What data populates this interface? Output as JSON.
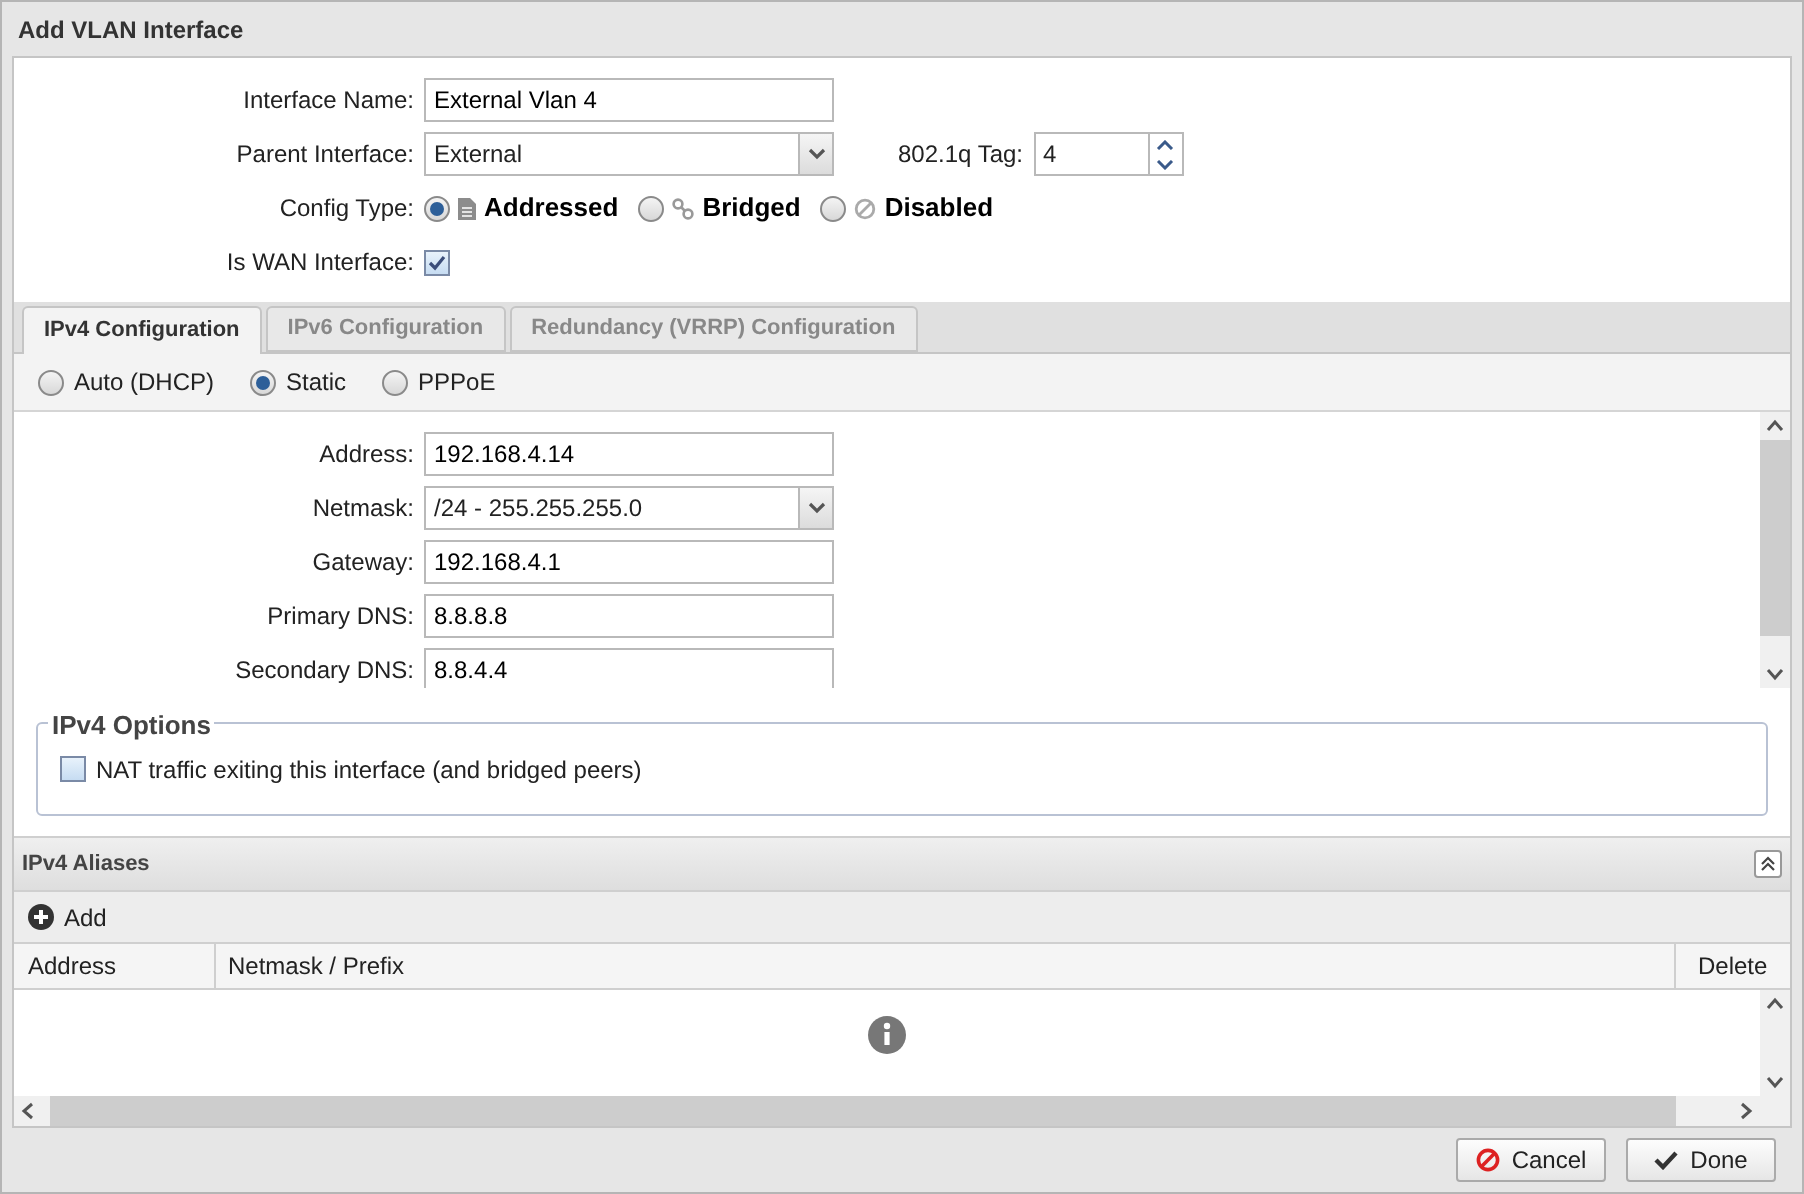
{
  "window": {
    "title": "Add VLAN Interface"
  },
  "form": {
    "interface_name": {
      "label": "Interface Name:",
      "value": "External Vlan 4"
    },
    "parent_interface": {
      "label": "Parent Interface:",
      "value": "External"
    },
    "vlan_tag": {
      "label": "802.1q Tag:",
      "value": "4"
    },
    "config_type": {
      "label": "Config Type:",
      "options": [
        {
          "label": "Addressed",
          "kind": "document",
          "selected": true
        },
        {
          "label": "Bridged",
          "kind": "link",
          "selected": false
        },
        {
          "label": "Disabled",
          "kind": "blocked",
          "selected": false
        }
      ]
    },
    "is_wan": {
      "label": "Is WAN Interface:",
      "checked": true
    }
  },
  "tabs": [
    {
      "label": "IPv4 Configuration",
      "selected": true
    },
    {
      "label": "IPv6 Configuration",
      "selected": false
    },
    {
      "label": "Redundancy (VRRP) Configuration",
      "selected": false
    }
  ],
  "ipv4_modes": [
    {
      "label": "Auto (DHCP)",
      "selected": false
    },
    {
      "label": "Static",
      "selected": true
    },
    {
      "label": "PPPoE",
      "selected": false
    }
  ],
  "ipv4_fields": [
    {
      "label": "Address:",
      "value": "192.168.4.14",
      "kind": "text"
    },
    {
      "label": "Netmask:",
      "value": "/24 - 255.255.255.0",
      "kind": "select"
    },
    {
      "label": "Gateway:",
      "value": "192.168.4.1",
      "kind": "text"
    },
    {
      "label": "Primary DNS:",
      "value": "8.8.8.8",
      "kind": "text"
    },
    {
      "label": "Secondary DNS:",
      "value": "8.8.4.4",
      "kind": "text"
    }
  ],
  "ipv4_options": {
    "title": "IPv4 Options",
    "nat": {
      "label": "NAT traffic exiting this interface (and bridged peers)",
      "checked": false
    }
  },
  "aliases": {
    "title": "IPv4 Aliases",
    "add_label": "Add",
    "columns": [
      "Address",
      "Netmask / Prefix",
      "Delete"
    ]
  },
  "buttons": [
    {
      "label": "Cancel",
      "kind": "cancel"
    },
    {
      "label": "Done",
      "kind": "done"
    }
  ]
}
